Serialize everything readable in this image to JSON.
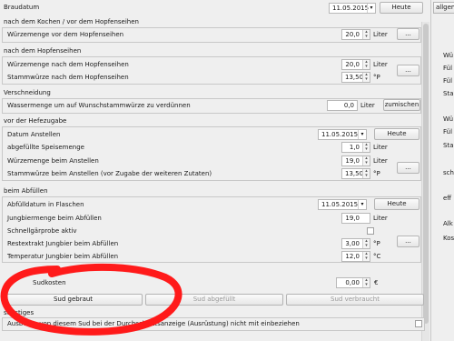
{
  "brew_date": {
    "label": "Braudatum",
    "value": "11.05.2015",
    "today_button": "Heute"
  },
  "right_panel": {
    "tab": "allgem",
    "items": [
      "Wü",
      "Fül",
      "Fül",
      "Sta",
      "Wü",
      "Fül",
      "Sta",
      "sch",
      "eff",
      "Alk",
      "Kos"
    ]
  },
  "after_boil": {
    "title": "nach dem Kochen / vor dem Hopfenseihen",
    "wort_label": "Würzemenge vor dem Hopfenseihen",
    "wort_value": "20,0",
    "wort_unit": "Liter",
    "button": "..."
  },
  "after_strain": {
    "title": "nach dem Hopfenseihen",
    "wort_label": "Würzemenge nach dem Hopfenseihen",
    "wort_value": "20,0",
    "wort_unit": "Liter",
    "gravity_label": "Stammwürze nach dem Hopfenseihen",
    "gravity_value": "13,50",
    "gravity_unit": "°P",
    "button": "..."
  },
  "dilution": {
    "title": "Verschneidung",
    "label": "Wassermenge um auf Wunschstammwürze zu verdünnen",
    "value": "0,0",
    "unit": "Liter",
    "button": "zumischen"
  },
  "before_yeast": {
    "title": "vor der Hefezugabe",
    "date_label": "Datum Anstellen",
    "date_value": "11.05.2015",
    "date_button": "Heute",
    "speise_label": "abgefüllte Speisemenge",
    "speise_value": "1,0",
    "speise_unit": "Liter",
    "wort_label": "Würzemenge beim Anstellen",
    "wort_value": "19,0",
    "wort_unit": "Liter",
    "gravity_label": "Stammwürze beim Anstellen (vor Zugabe der weiteren Zutaten)",
    "gravity_value": "13,50",
    "gravity_unit": "°P",
    "button": "..."
  },
  "bottling": {
    "title": "beim Abfüllen",
    "date_label": "Abfülldatum in Flaschen",
    "date_value": "11.05.2015",
    "date_button": "Heute",
    "green_beer_label": "Jungbiermenge beim Abfüllen",
    "green_beer_value": "19,0",
    "green_beer_unit": "Liter",
    "quick_test_label": "Schnellgärprobe aktiv",
    "extract_label": "Restextrakt Jungbier beim Abfüllen",
    "extract_value": "3,00",
    "extract_unit": "°P",
    "temp_label": "Temperatur Jungbier beim Abfüllen",
    "temp_value": "12,0",
    "temp_unit": "°C",
    "button": "..."
  },
  "costs": {
    "label": "Sudkosten",
    "value": "0,00",
    "unit": "€"
  },
  "actions": {
    "brewed": "Sud gebraut",
    "bottled": "Sud abgefüllt",
    "consumed": "Sud verbraucht"
  },
  "misc": {
    "title": "sonstiges",
    "exclude_label": "Ausbeute von diesem Sud bei der Durchschnittsanzeige (Ausrüstung) nicht mit einbeziehen"
  },
  "annotation": {
    "color": "#ff1a1a"
  }
}
